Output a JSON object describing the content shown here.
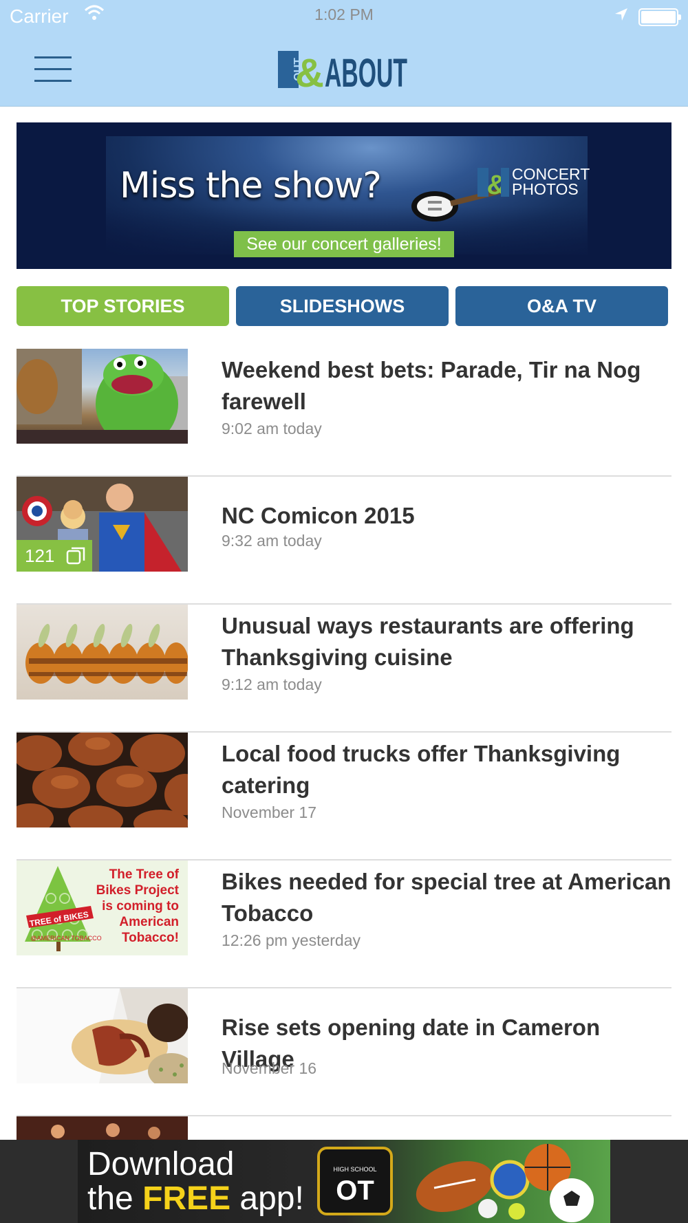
{
  "status_bar": {
    "carrier": "Carrier",
    "time": "1:02 PM"
  },
  "header": {
    "logo_text": "OUT&ABOUT"
  },
  "banner": {
    "headline": "Miss the show?",
    "brand_line1": "CONCERT",
    "brand_line2": "PHOTOS",
    "cta": "See our concert galleries!"
  },
  "tabs": [
    {
      "label": "TOP STORIES",
      "active": true
    },
    {
      "label": "SLIDESHOWS",
      "active": false
    },
    {
      "label": "O&A TV",
      "active": false
    }
  ],
  "stories": [
    {
      "title": "Weekend best bets: Parade, Tir na Nog farewell",
      "time": "9:02 am today",
      "image": "kermit-balloon-parade"
    },
    {
      "title": "NC Comicon 2015",
      "time": "9:32 am today",
      "image": "cosplay-superman",
      "gallery_count": "121"
    },
    {
      "title": "Unusual ways restaurants are offering Thanksgiving cuisine",
      "time": "9:12 am today",
      "image": "sushi-rolls"
    },
    {
      "title": "Local food trucks offer Thanksgiving catering",
      "time": "November 17",
      "image": "roasted-turkeys"
    },
    {
      "title": "Bikes needed for special tree at American Tobacco",
      "time": "12:26 pm yesterday",
      "image": "tree-of-bikes-poster",
      "poster_lines": [
        "The Tree of",
        "Bikes Project",
        "is coming to",
        "American",
        "Tobacco!"
      ],
      "poster_badge": "TREE of BIKES",
      "poster_sub": "@AMERICAN TOBACCO"
    },
    {
      "title": "Rise sets opening date in Cameron Village",
      "time": "November 16",
      "image": "bacon-donuts"
    }
  ],
  "bottom_ad": {
    "line1": "Download",
    "line2_pre": "the ",
    "line2_highlight": "FREE",
    "line2_post": " app!",
    "app_small": "HIGH SCHOOL",
    "app_big": "OT"
  },
  "colors": {
    "header_bg": "#b3d9f7",
    "tab_active": "#87c043",
    "tab_inactive": "#2a6399",
    "title_text": "#333333",
    "timestamp_text": "#8c8c8c"
  }
}
